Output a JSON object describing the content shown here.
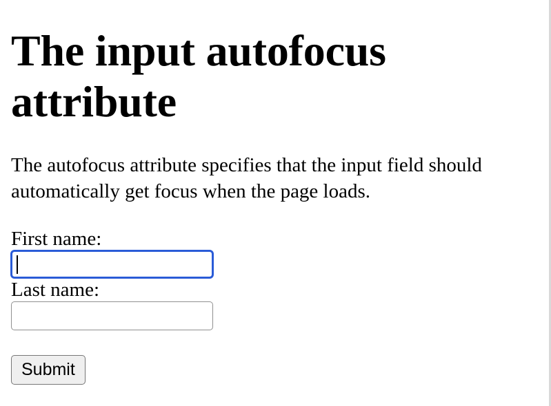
{
  "page": {
    "heading": "The input autofocus attribute",
    "intro": "The autofocus attribute specifies that the input field should automatically get focus when the page loads."
  },
  "form": {
    "first_name_label": "First name:",
    "first_name_value": "",
    "last_name_label": "Last name:",
    "last_name_value": "",
    "submit_label": "Submit",
    "focused_field": "first_name"
  },
  "colors": {
    "focus_ring": "#2a5bd7",
    "input_border": "#8f8f8f",
    "button_background": "#efefef"
  }
}
